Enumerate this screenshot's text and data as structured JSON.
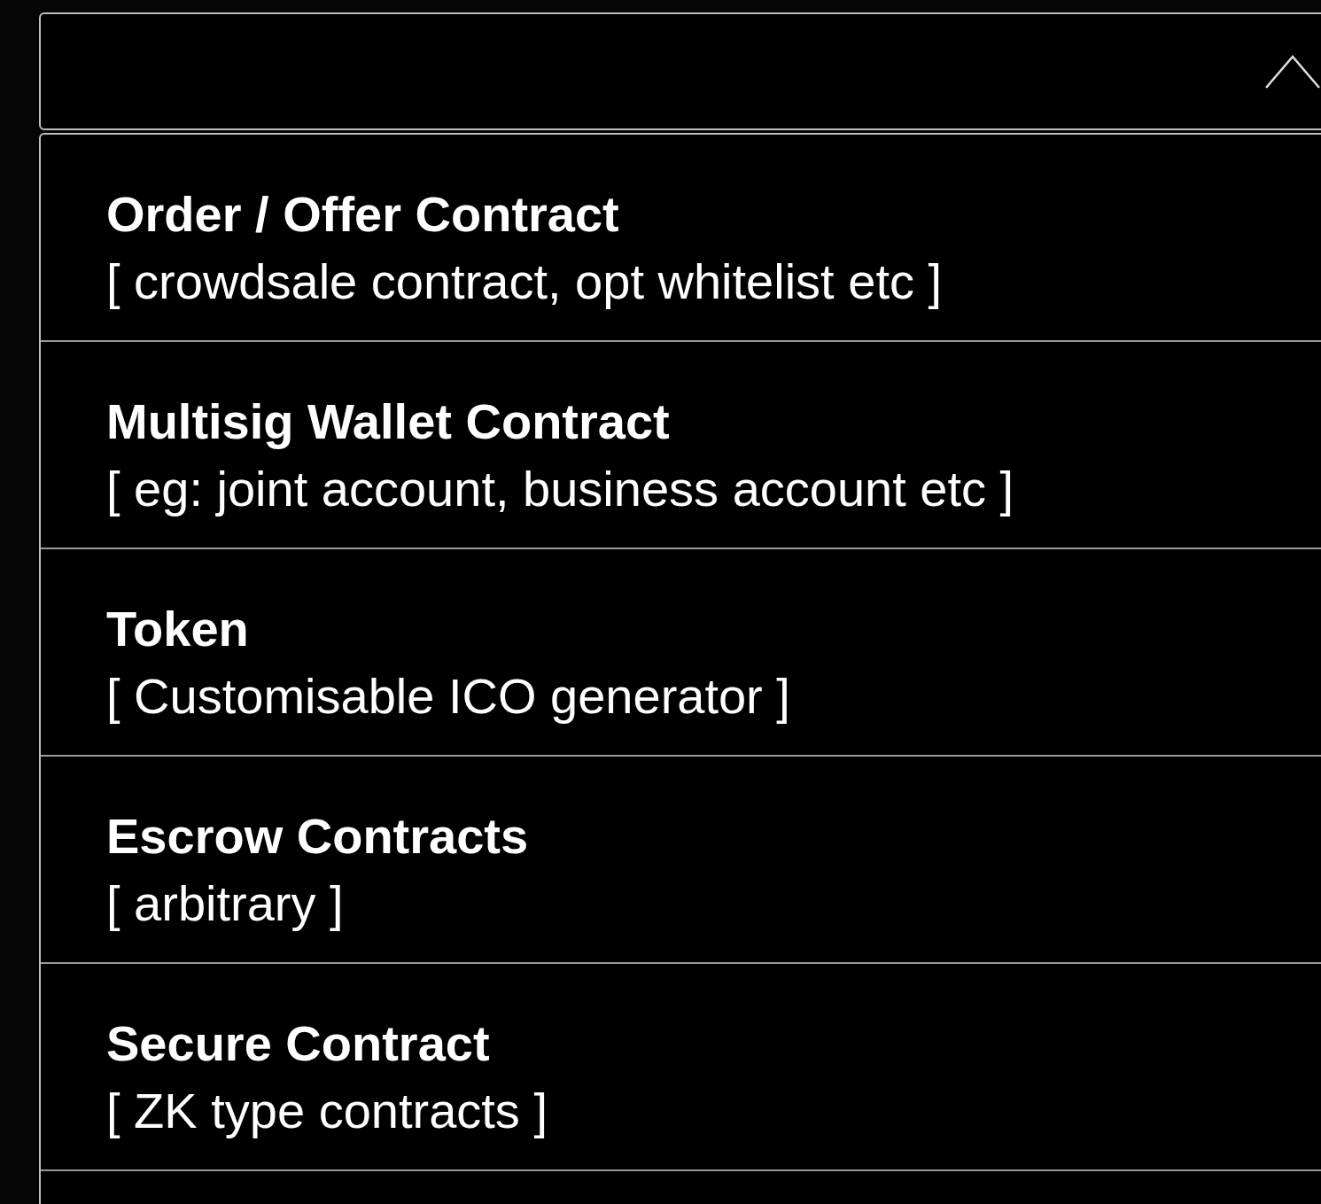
{
  "dropdown": {
    "expanded": true
  },
  "options": [
    {
      "title": "Order / Offer Contract",
      "subtitle": "[ crowdsale contract, opt whitelist etc ]"
    },
    {
      "title": "Multisig Wallet Contract",
      "subtitle": "[ eg: joint account, business account etc ]"
    },
    {
      "title": "Token",
      "subtitle": "[ Customisable ICO generator ]"
    },
    {
      "title": "Escrow Contracts",
      "subtitle": "[ arbitrary ]"
    },
    {
      "title": "Secure Contract",
      "subtitle": "[ ZK type contracts ]"
    }
  ]
}
